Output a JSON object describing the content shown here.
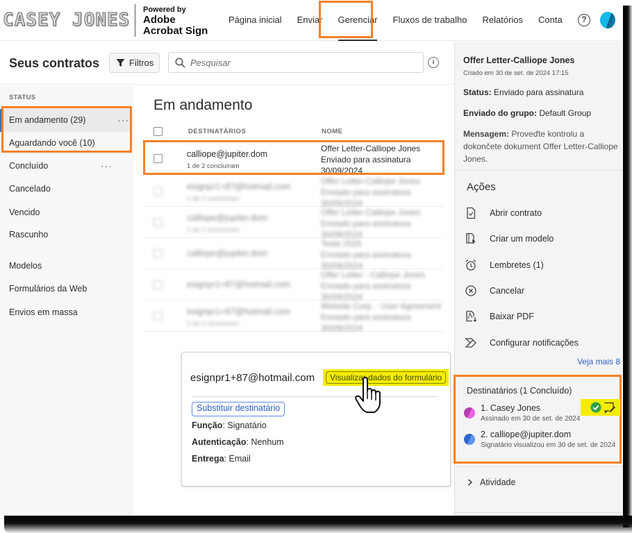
{
  "header": {
    "brand_logo_text": "CASEY JONES",
    "powered_by": "Powered by",
    "product_line1": "Adobe",
    "product_line2": "Acrobat Sign",
    "nav": [
      {
        "label": "Página inicial",
        "active": false
      },
      {
        "label": "Enviar",
        "active": false
      },
      {
        "label": "Gerenciar",
        "active": true
      },
      {
        "label": "Fluxos de trabalho",
        "active": false
      },
      {
        "label": "Relatórios",
        "active": false
      },
      {
        "label": "Conta",
        "active": false
      }
    ],
    "help_icon": "?",
    "highlight_color": "#f58025"
  },
  "toolbar": {
    "page_title": "Seus contratos",
    "filter_label": "Filtros",
    "search_placeholder": "Pesquisar",
    "info_icon": "i"
  },
  "sidebar": {
    "status_heading": "STATUS",
    "items": [
      {
        "label": "Em andamento (29)",
        "selected": true,
        "more": "···"
      },
      {
        "label": "Aguardando você (10)",
        "selected": false
      },
      {
        "label": "Concluído",
        "selected": false,
        "more": "···"
      },
      {
        "label": "Cancelado",
        "selected": false
      },
      {
        "label": "Vencido",
        "selected": false
      },
      {
        "label": "Rascunho",
        "selected": false
      }
    ],
    "other_items": [
      {
        "label": "Modelos"
      },
      {
        "label": "Formulários da Web"
      },
      {
        "label": "Envios em massa"
      }
    ]
  },
  "list": {
    "title": "Em andamento",
    "columns": {
      "recipients": "DESTINATÁRIOS",
      "name": "NOME"
    },
    "rows": [
      {
        "email": "calliope@jupiter.dom",
        "progress": "1 de 2 concluíram",
        "name": "Offer Letter-Calliope Jones",
        "status": "Enviado para assinatura",
        "date": "30/09/2024",
        "blurred": false
      },
      {
        "email": "esignpr1+87@hotmail.com",
        "progress": "1 de 2 concluíram",
        "name": "Offer Letter-Calliope Jones",
        "status": "Enviado para assinatura",
        "date": "30/09/2024",
        "blurred": true
      },
      {
        "email": "calliope@jupiter.dom",
        "progress": "1 de 2 concluíram",
        "name": "Offer Letter-Calliope Jones",
        "status": "Enviado para assinatura",
        "date": "30/09/2024",
        "blurred": true
      },
      {
        "email": "calliope@jupiter.dom",
        "progress": "",
        "name": "Teste 2025",
        "status": "Enviado para assinatura",
        "date": "30/09/2024",
        "blurred": true
      },
      {
        "email": "esignpr1+87@hotmail.com",
        "progress": "",
        "name": "Offer Letter - Calliope Jones",
        "status": "Enviado para assinatura",
        "date": "30/09/2024",
        "blurred": true
      },
      {
        "email": "esignpr1+87@hotmail.com",
        "progress": "1 de 2 concluíram",
        "name": "Website Corp. - User Agreement",
        "status": "Enviado para assinatura",
        "date": "30/09/2024",
        "blurred": true
      }
    ]
  },
  "popover": {
    "email": "esignpr1+87@hotmail.com",
    "view_form_button": "Visualizar dados do formulário",
    "replace_button": "Substituir destinatário",
    "fields": [
      {
        "label": "Função",
        "value": "Signatário"
      },
      {
        "label": "Autenticação",
        "value": "Nenhum"
      },
      {
        "label": "Entrega",
        "value": "Email"
      }
    ]
  },
  "details": {
    "title": "Offer Letter-Calliope Jones",
    "created": "Criado em 30 de set. de 2024 17:15",
    "status_label": "Status:",
    "status_value": "Enviado para assinatura",
    "group_label": "Enviado do grupo:",
    "group_value": "Default Group",
    "message_label": "Mensagem:",
    "message_value": "Proveďte kontrolu a dokončete dokument Offer Letter-Calliope Jones.",
    "actions_title": "Ações",
    "actions": [
      {
        "label": "Abrir contrato",
        "icon": "open-document-icon"
      },
      {
        "label": "Criar um modelo",
        "icon": "create-template-icon"
      },
      {
        "label": "Lembretes (1)",
        "icon": "alarm-clock-icon"
      },
      {
        "label": "Cancelar",
        "icon": "cancel-circle-icon"
      },
      {
        "label": "Baixar PDF",
        "icon": "download-pdf-icon"
      },
      {
        "label": "Configurar notificações",
        "icon": "notifications-icon"
      }
    ],
    "see_more": "Veja mais 8",
    "recipients_title": "Destinatários (1 Concluído)",
    "recipients": [
      {
        "name": "1. Casey Jones",
        "detail": "Assinado em 30 de set. de 2024",
        "color": "#d452c7"
      },
      {
        "name": "2. calliope@jupiter.dom",
        "detail": "Signatário visualizou em 30 de set. de 2024",
        "color": "#4a86e8"
      }
    ],
    "activity_label": "Atividade"
  }
}
